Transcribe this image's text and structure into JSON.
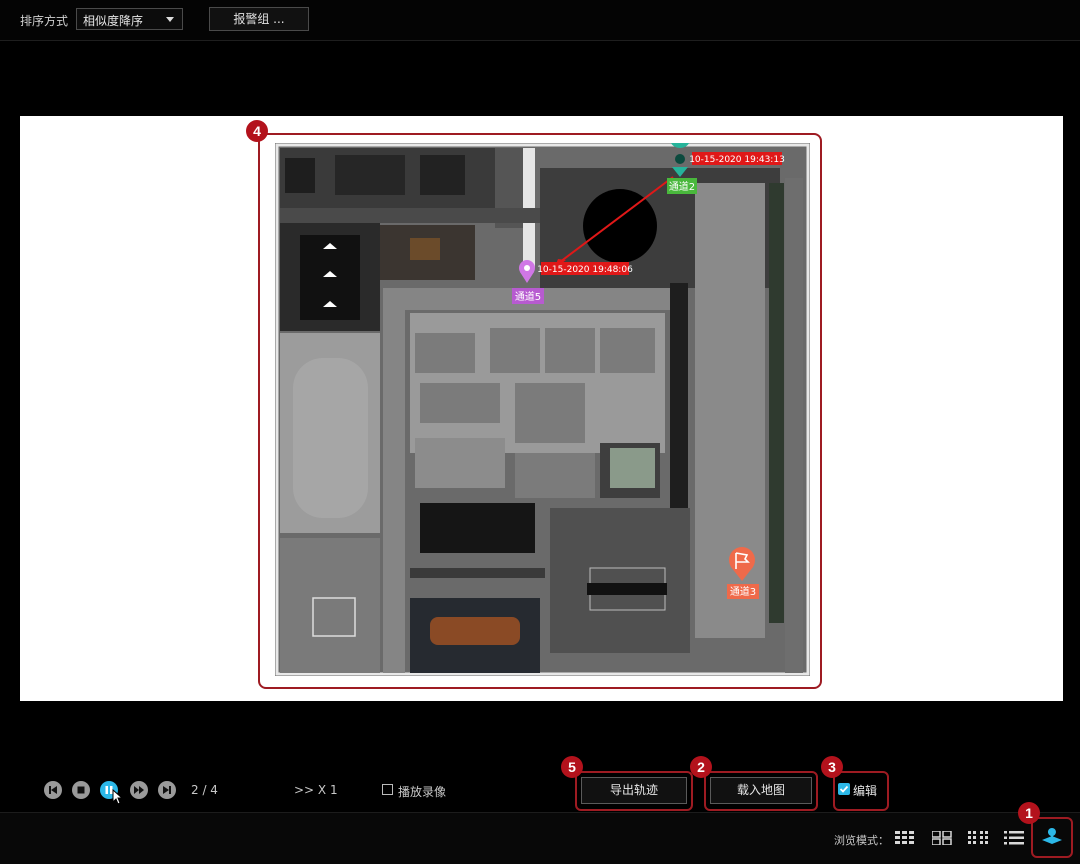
{
  "toolbar": {
    "sort_label": "排序方式",
    "sort_value": "相似度降序",
    "alarm_group_button": "报警组 ..."
  },
  "map": {
    "markers": [
      {
        "channel": "通道2",
        "timestamp": "10-15-2020 19:43:13",
        "color": "#26b39a"
      },
      {
        "channel": "通道5",
        "timestamp": "10-15-2020 19:48:06",
        "color": "#c468d8"
      },
      {
        "channel": "通道3",
        "timestamp": "",
        "color": "#e8684a"
      }
    ],
    "track_color": "#e01818"
  },
  "playback": {
    "counter": "2 / 4",
    "speed": ">> X 1",
    "play_recording_label": "播放录像",
    "play_recording_checked": false
  },
  "actions": {
    "export_track": "导出轨迹",
    "load_map": "载入地图",
    "edit_label": "编辑",
    "edit_checked": true
  },
  "statusbar": {
    "browse_mode_label": "浏览模式："
  },
  "callouts": {
    "b1": "1",
    "b2": "2",
    "b3": "3",
    "b4": "4",
    "b5": "5"
  },
  "colors": {
    "callout_red": "#b3121c",
    "accent": "#2cb8e8"
  }
}
